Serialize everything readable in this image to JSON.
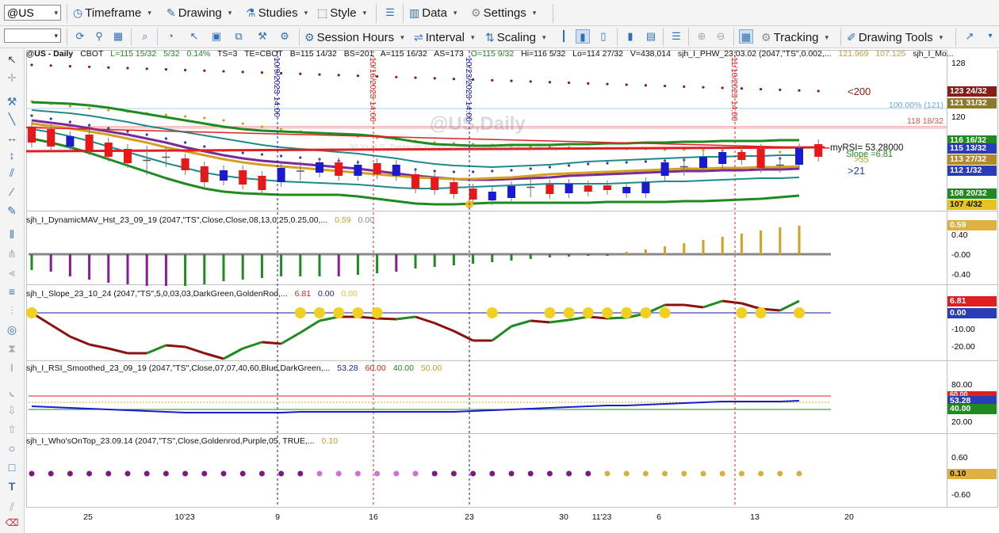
{
  "toolbar1": {
    "symbol": "@US",
    "menus": [
      "Timeframe",
      "Drawing",
      "Studies",
      "Style",
      "Data",
      "Settings"
    ]
  },
  "toolbar2": {
    "menus": [
      "Session Hours",
      "Interval",
      "Scaling",
      "Tracking",
      "Drawing Tools"
    ]
  },
  "header_line": {
    "symbol": "@US - Daily",
    "exchange": "CBOT",
    "last": "L=115 15/32",
    "change": "5/32",
    "pct": "0.14%",
    "ts": "TS=3",
    "te": "TE=CBOT",
    "bid": "B=115 14/32",
    "bs": "BS=201",
    "ask": "A=115 16/32",
    "as": "AS=173",
    "open": "O=115 9/32",
    "high": "Hi=116 5/32",
    "low": "Lo=114 27/32",
    "vol": "V=438,014",
    "study": "sjh_I_PHW_23.03.02 (2047,\"TS\",0.002,...",
    "v1": "121.969",
    "v2": "107.125",
    "study2": "sjh_I_Mo..."
  },
  "watermark": "@US,Daily",
  "watermark_sub": "30 Yr U.S. Treasury Bonds Continuous Contract [Dec23]",
  "vlines": [
    {
      "label": "10/9/2023 14:00",
      "color": "#1a1aa8"
    },
    {
      "label": "10/16/2023 14:00",
      "color": "#e02020"
    },
    {
      "label": "10/23/2023 14:00",
      "color": "#1a1aa8"
    },
    {
      "label": "11/10/2023 14:00",
      "color": "#e02020"
    }
  ],
  "price_pane": {
    "axis_ticks": [
      "128",
      "120"
    ],
    "annotations": {
      "lt200": "<200",
      "pct100": "100.00% (121)",
      "line118": "118 18/32",
      "myrsi": "myRSI= 53.28000",
      "slope": "Slope =6.81",
      "n35": ">35",
      "gt21": ">21"
    },
    "labels": [
      {
        "text": "123 24/32",
        "bg": "#8b1a1a"
      },
      {
        "text": "121 31/32",
        "bg": "#8a7a2a"
      },
      {
        "text": "116 16/32",
        "bg": "#1f8a1f"
      },
      {
        "text": "115 13/32",
        "bg": "#2a3db8"
      },
      {
        "text": "113 27/32",
        "bg": "#b38a2a"
      },
      {
        "text": "112 1/32",
        "bg": "#2a3db8"
      },
      {
        "text": "108 20/32",
        "bg": "#1f8a1f"
      },
      {
        "text": "107 4/32",
        "bg": "#e6c420"
      }
    ]
  },
  "studies": [
    {
      "name": "sjh_I_DynamicMAV_Hst_23_09_19 (2047,\"TS\",Close,Close,08,13,0.25,0.25,00,...",
      "values": [
        {
          "v": "0.59",
          "c": "#c89a2a"
        },
        {
          "v": "0.00",
          "c": "#888888"
        }
      ],
      "ticks": [
        "0.40",
        "-0.00",
        "-0.40"
      ],
      "labels": [
        {
          "text": "0.59",
          "bg": "#e0b040"
        }
      ]
    },
    {
      "name": "sjh_I_Slope_23_10_24 (2047,\"TS\",5,0,03,03,DarkGreen,GoldenRod,...",
      "values": [
        {
          "v": "6.81",
          "c": "#e02020"
        },
        {
          "v": "0.00",
          "c": "#1a1aa8"
        },
        {
          "v": "0.00",
          "c": "#e6c420"
        }
      ],
      "ticks": [
        "-10.00",
        "-20.00"
      ],
      "labels": [
        {
          "text": "6.81",
          "bg": "#e02020"
        },
        {
          "text": "0.00",
          "bg": "#2a3db8"
        }
      ]
    },
    {
      "name": "sjh_I_RSI_Smoothed_23_09_19 (2047,\"TS\",Close,07,07,40,60,Blue,DarkGreen,...",
      "values": [
        {
          "v": "53.28",
          "c": "#1a1aa8"
        },
        {
          "v": "60.00",
          "c": "#e02020"
        },
        {
          "v": "40.00",
          "c": "#1f8a1f"
        },
        {
          "v": "50.00",
          "c": "#c89a2a"
        }
      ],
      "ticks": [
        "80.00",
        "20.00"
      ],
      "labels": [
        {
          "text": "60.00",
          "bg": "#e02020"
        },
        {
          "text": "53.28",
          "bg": "#2a3db8"
        },
        {
          "text": "40.00",
          "bg": "#1f8a1f"
        }
      ]
    },
    {
      "name": "sjh_I_Who'sOnTop_23.09.14 (2047,\"TS\",Close,Goldenrod,Purple,05,  TRUE,...",
      "values": [
        {
          "v": "0.10",
          "c": "#c89a2a"
        }
      ],
      "ticks": [
        "0.60",
        "-0.60"
      ],
      "labels": [
        {
          "text": "0.10",
          "bg": "#e0b040"
        }
      ]
    }
  ],
  "x_axis": [
    "25",
    "10'23",
    "9",
    "16",
    "23",
    "30",
    "11'23",
    "6",
    "13",
    "20"
  ]
}
